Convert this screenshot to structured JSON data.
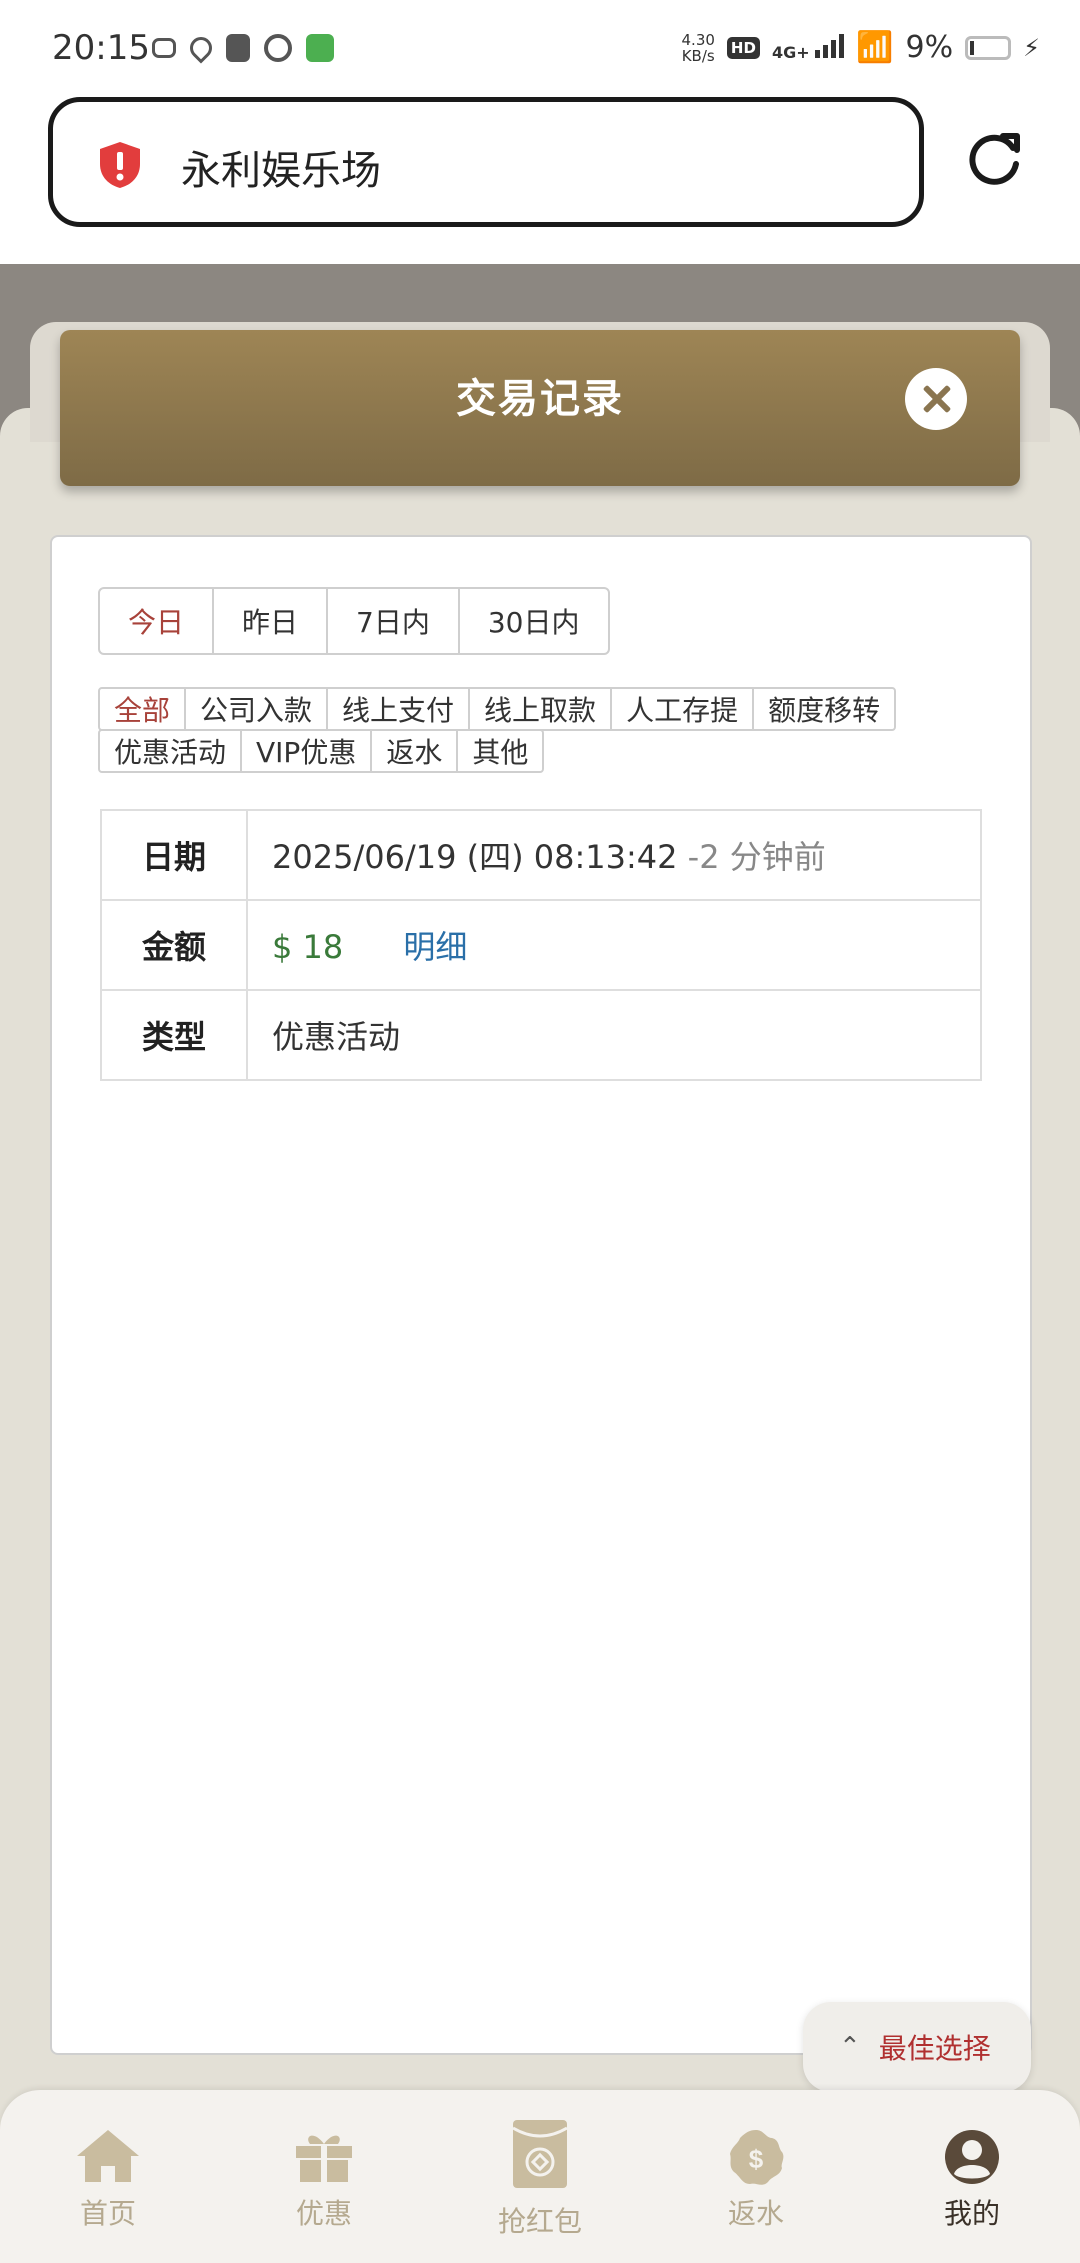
{
  "status_bar": {
    "time": "20:15",
    "net_speed_value": "4.30",
    "net_speed_unit": "KB/s",
    "hd": "HD",
    "network": "4G+",
    "battery_pct": "9%"
  },
  "browser": {
    "url_title": "永利娱乐场"
  },
  "modal": {
    "title": "交易记录"
  },
  "range_tabs": [
    {
      "label": "今日",
      "active": true
    },
    {
      "label": "昨日",
      "active": false
    },
    {
      "label": "7日内",
      "active": false
    },
    {
      "label": "30日内",
      "active": false
    }
  ],
  "type_tabs_row1": [
    {
      "label": "全部",
      "active": true
    },
    {
      "label": "公司入款",
      "active": false
    },
    {
      "label": "线上支付",
      "active": false
    },
    {
      "label": "线上取款",
      "active": false
    },
    {
      "label": "人工存提",
      "active": false
    },
    {
      "label": "额度移转",
      "active": false
    }
  ],
  "type_tabs_row2": [
    {
      "label": "优惠活动",
      "active": false
    },
    {
      "label": "VIP优惠",
      "active": false
    },
    {
      "label": "返水",
      "active": false
    },
    {
      "label": "其他",
      "active": false
    }
  ],
  "record": {
    "date_label": "日期",
    "date_value": "2025/06/19 (四) 08:13:42",
    "date_ago": "-2 分钟前",
    "amount_label": "金额",
    "amount_value": "$ 18",
    "detail_link": "明细",
    "type_label": "类型",
    "type_value": "优惠活动"
  },
  "floating": {
    "best_choice": "最佳选择"
  },
  "bottom_nav": {
    "home": "首页",
    "promo": "优惠",
    "red_packet": "抢红包",
    "rebate": "返水",
    "mine": "我的"
  },
  "colors": {
    "header_gold": "#9e8555",
    "active_red": "#a8423a",
    "amount_green": "#3a7a3a",
    "link_blue": "#2a6fa8",
    "nav_inactive": "#b5a98f"
  }
}
